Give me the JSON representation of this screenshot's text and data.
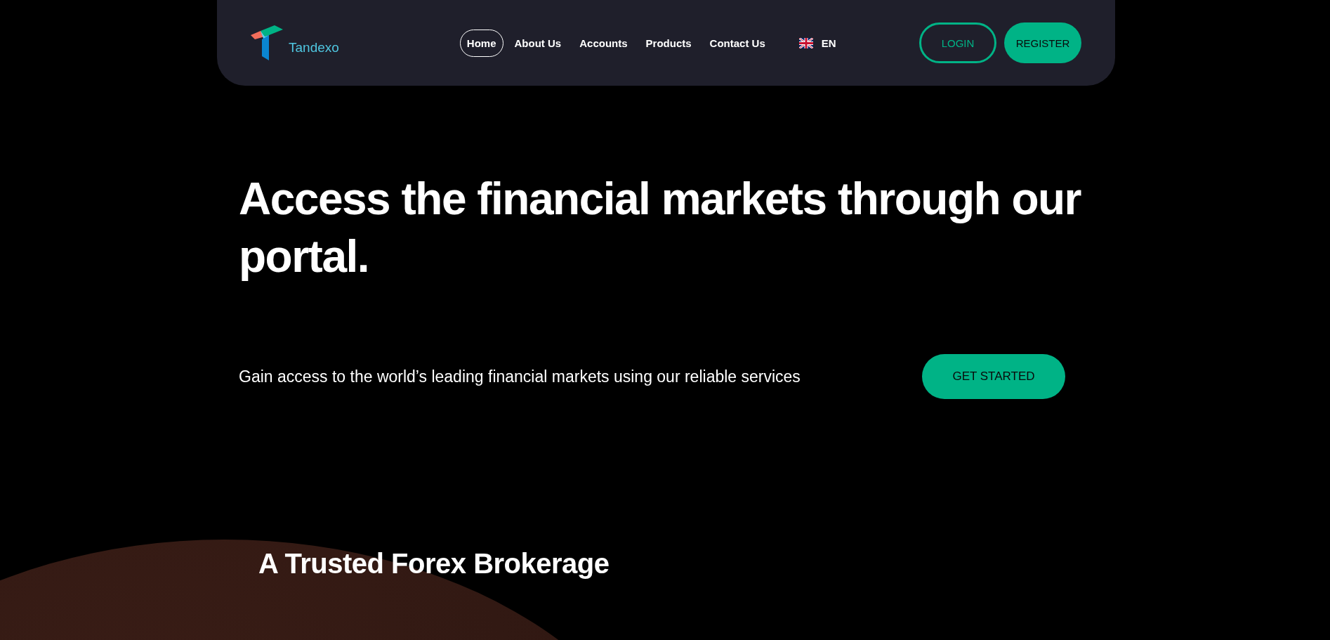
{
  "header": {
    "logo_text": "Tandexo",
    "nav": [
      {
        "label": "Home",
        "selected": true
      },
      {
        "label": "About Us",
        "selected": false
      },
      {
        "label": "Accounts",
        "selected": false
      },
      {
        "label": "Products",
        "selected": false
      },
      {
        "label": "Contact Us",
        "selected": false
      }
    ],
    "language": "EN",
    "login": "LOGIN",
    "register": "REGISTER"
  },
  "hero": {
    "title": "Access the financial markets through our portal.",
    "subtitle": "Gain access to the world’s leading financial markets using our reliable services",
    "cta": "GET STARTED"
  },
  "section": {
    "title": "A Trusted Forex Brokerage"
  }
}
